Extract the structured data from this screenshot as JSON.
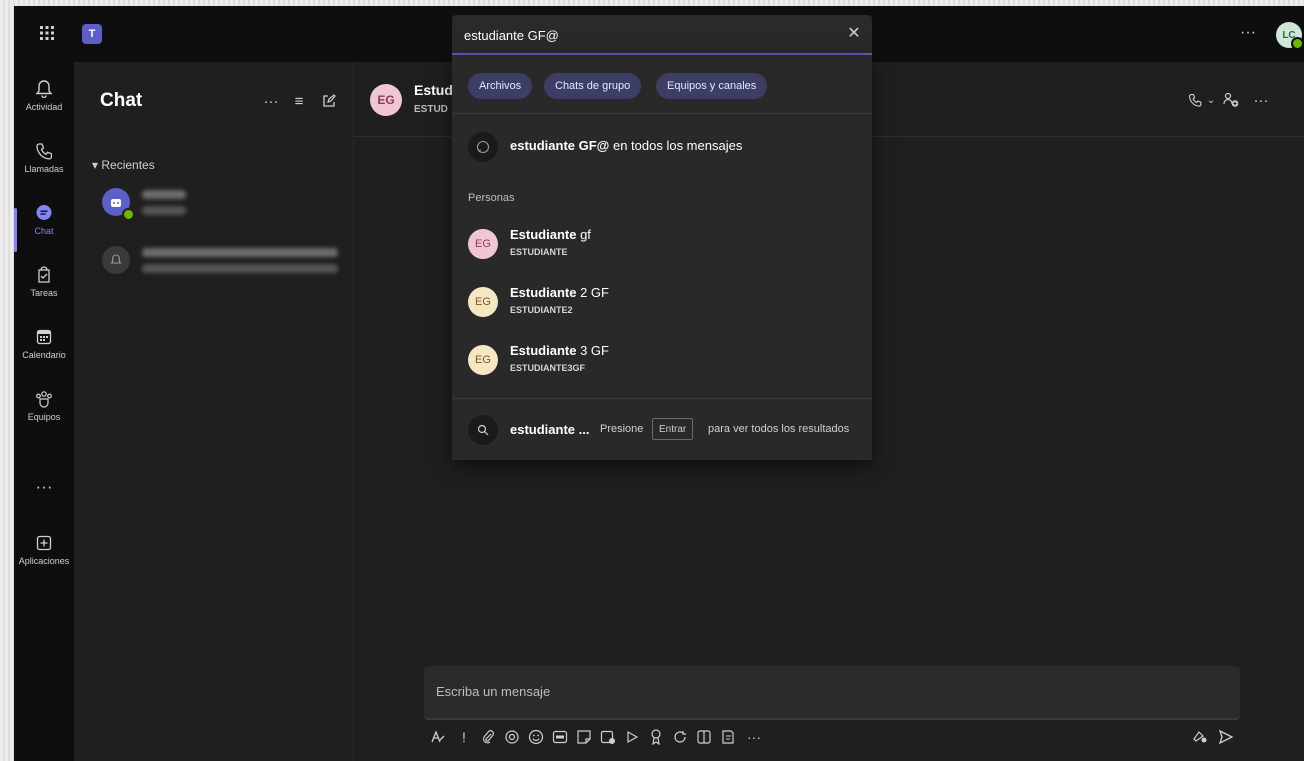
{
  "topbar": {
    "waffle_icon": "grid-icon",
    "logo_text": "T",
    "more_label": "···",
    "user_initials": "LC"
  },
  "rail": {
    "items": [
      {
        "label": "Actividad",
        "icon": "bell-icon",
        "glyph": "🔔︎"
      },
      {
        "label": "Llamadas",
        "icon": "phone-icon",
        "glyph": "✆"
      },
      {
        "label": "Chat",
        "icon": "chat-icon",
        "glyph": "💬︎"
      },
      {
        "label": "Tareas",
        "icon": "tasks-icon",
        "glyph": "▣"
      },
      {
        "label": "Calendario",
        "icon": "calendar-icon",
        "glyph": "▦"
      },
      {
        "label": "Equipos",
        "icon": "teams-icon",
        "glyph": "⚇"
      },
      {
        "label": "",
        "icon": "more-apps-icon",
        "glyph": "···"
      },
      {
        "label": "Aplicaciones",
        "icon": "apps-icon",
        "glyph": "⊞"
      }
    ],
    "active_color": "#7f85f5"
  },
  "chatlist": {
    "title": "Chat",
    "more_glyph": "···",
    "filter_glyph": "≡",
    "new_chat_glyph": "✎",
    "section_label": "▾ Recientes"
  },
  "conversation": {
    "avatar_initials": "EG",
    "name": "Estud",
    "subtitle": "ESTUD",
    "header_more": "···",
    "composer_placeholder": "Escriba un mensaje",
    "toolbar_more": "···"
  },
  "search": {
    "query": "estudiante GF@",
    "clear_glyph": "✕",
    "filters": [
      "Archivos",
      "Chats de grupo",
      "Equipos y canales"
    ],
    "message_search": {
      "bold": "estudiante GF@",
      "rest": " en todos los mensajes"
    },
    "people_label": "Personas",
    "people": [
      {
        "initials": "EG",
        "name_bold": "Estudiante",
        "name_rest": " gf",
        "login": "ESTUDIANTE",
        "bg": "#f1c6d4",
        "fg": "#8d3b5a"
      },
      {
        "initials": "EG",
        "name_bold": "Estudiante",
        "name_rest": " 2 GF",
        "login": "ESTUDIANTE2",
        "bg": "#f5e6c4",
        "fg": "#7a5a1c"
      },
      {
        "initials": "EG",
        "name_bold": "Estudiante",
        "name_rest": " 3 GF",
        "login": "ESTUDIANTE3GF",
        "bg": "#f5e6c4",
        "fg": "#7a5a1c"
      }
    ],
    "all_results": {
      "query_short": "estudiante ...",
      "press": "Presione",
      "key": "Entrar",
      "rest": "para ver todos los resultados"
    }
  },
  "colors": {
    "accent": "#5b5fc7",
    "chip_bg": "#3d3e66",
    "presence": "#6bb700"
  }
}
